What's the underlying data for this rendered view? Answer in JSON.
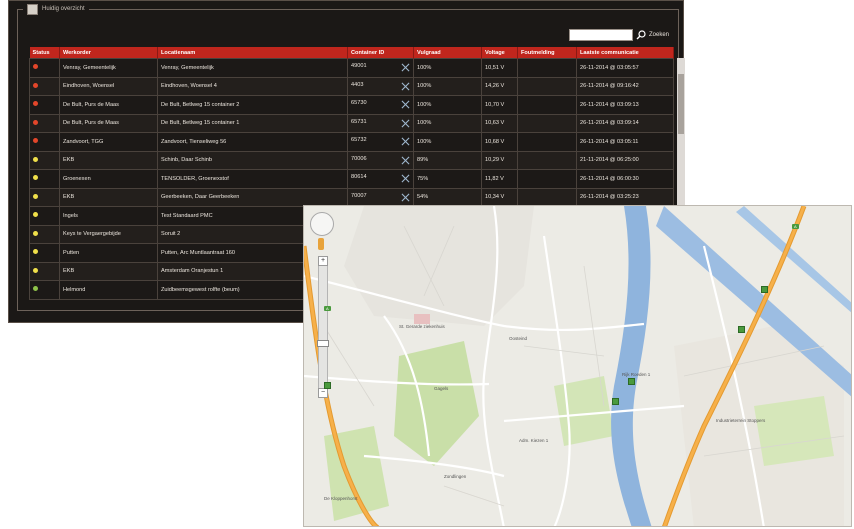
{
  "panel": {
    "legend_label": "Huidig overzicht",
    "search": {
      "value": "",
      "placeholder": "",
      "button_label": "Zoeken"
    }
  },
  "table": {
    "columns": [
      "Status",
      "Werkorder",
      "Locatienaam",
      "Container ID",
      "Vulgraad",
      "Voltage",
      "Foutmelding",
      "Laatste communicatie"
    ],
    "rows": [
      {
        "status_color": "#e3462a",
        "werkorder": "Venray, Gemeentelijk",
        "locatie": "Venray, Gemeentelijk",
        "container": "49001",
        "vulgraad": "100%",
        "voltage": "10,51 V",
        "fout": "",
        "laatste": "26-11-2014 @ 03:05:57"
      },
      {
        "status_color": "#e3462a",
        "werkorder": "Eindhoven, Woensel",
        "locatie": "Eindhoven, Woensel 4",
        "container": "4403",
        "vulgraad": "100%",
        "voltage": "14,26 V",
        "fout": "",
        "laatste": "26-11-2014 @ 09:16:42"
      },
      {
        "status_color": "#e3462a",
        "werkorder": "De Bult, Purs de Maas",
        "locatie": "De Bult, Betlweg 15 container 2",
        "container": "65730",
        "vulgraad": "100%",
        "voltage": "10,70 V",
        "fout": "",
        "laatste": "26-11-2014 @ 03:09:13"
      },
      {
        "status_color": "#e3462a",
        "werkorder": "De Bult, Purs de Maas",
        "locatie": "De Bult, Betlweg 15 container 1",
        "container": "65731",
        "vulgraad": "100%",
        "voltage": "10,63 V",
        "fout": "",
        "laatste": "26-11-2014 @ 03:09:14"
      },
      {
        "status_color": "#e3462a",
        "werkorder": "Zandvoort, TGG",
        "locatie": "Zandvoort, Tienseliweg 56",
        "container": "65732",
        "vulgraad": "100%",
        "voltage": "10,68 V",
        "fout": "",
        "laatste": "26-11-2014 @ 03:05:11"
      },
      {
        "status_color": "#f0e04a",
        "werkorder": "EKB",
        "locatie": "Schinb, Daar Schinb",
        "container": "70006",
        "vulgraad": "89%",
        "voltage": "10,29 V",
        "fout": "",
        "laatste": "21-11-2014 @ 06:25:00"
      },
      {
        "status_color": "#f0e04a",
        "werkorder": "Groenexen",
        "locatie": "TENSOLDER, Groenexstof",
        "container": "80614",
        "vulgraad": "75%",
        "voltage": "11,82 V",
        "fout": "",
        "laatste": "26-11-2014 @ 06:00:30"
      },
      {
        "status_color": "#f0e04a",
        "werkorder": "EKB",
        "locatie": "Geerbeeken, Daar Geerbeeken",
        "container": "70007",
        "vulgraad": "54%",
        "voltage": "10,34 V",
        "fout": "",
        "laatste": "26-11-2014 @ 03:25:23"
      },
      {
        "status_color": "#f0e04a",
        "werkorder": "Ingels",
        "locatie": "Test Standaard PMC",
        "container": "",
        "vulgraad": "",
        "voltage": "",
        "fout": "",
        "laatste": ""
      },
      {
        "status_color": "#f0e04a",
        "werkorder": "Keys te Vergaergebijde",
        "locatie": "Soruit 2",
        "container": "",
        "vulgraad": "",
        "voltage": "",
        "fout": "",
        "laatste": ""
      },
      {
        "status_color": "#f0e04a",
        "werkorder": "Putten",
        "locatie": "Putten, Arc Muntlaantraat 160",
        "container": "",
        "vulgraad": "",
        "voltage": "",
        "fout": "",
        "laatste": ""
      },
      {
        "status_color": "#f0e04a",
        "werkorder": "EKB",
        "locatie": "Amsterdam Oranjestun 1",
        "container": "",
        "vulgraad": "",
        "voltage": "",
        "fout": "",
        "laatste": ""
      },
      {
        "status_color": "#8fc34a",
        "werkorder": "Helmond",
        "locatie": "Zuidbeemsgewest rolfte (beum)",
        "container": "",
        "vulgraad": "",
        "voltage": "",
        "fout": "",
        "laatste": ""
      }
    ]
  },
  "map": {
    "labels": [
      "St. Gerarde ziekenhuis",
      "Oosteind",
      "Gagels",
      "Adm. Kiezen 1",
      "Rijk Roeden 1",
      "Industrieterrein Stoppers",
      "Zondlingen",
      "De Kloppenhorst"
    ],
    "controls": {
      "zoom_in": "+",
      "zoom_out": "−"
    }
  },
  "colors": {
    "header_red": "#c0261d",
    "panel_bg": "#1b1816",
    "map_bg": "#ecebe5",
    "highway": "#f2a43c",
    "water": "#8fb4dd",
    "park": "#c9dfa8"
  }
}
